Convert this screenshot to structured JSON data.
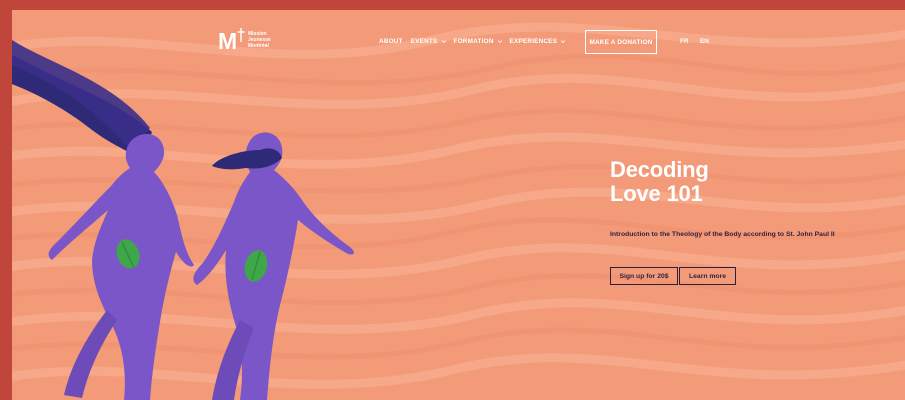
{
  "brand": {
    "logo_letter": "M",
    "logo_lines": [
      "Mission",
      "Jeunesse",
      "Montréal"
    ]
  },
  "nav": {
    "items": [
      {
        "label": "ABOUT",
        "has_dropdown": false
      },
      {
        "label": "EVENTS",
        "has_dropdown": true
      },
      {
        "label": "FORMATION",
        "has_dropdown": true
      },
      {
        "label": "EXPERIENCES",
        "has_dropdown": true
      }
    ],
    "donate_label": "MAKE A DONATION",
    "lang_fr": "FR",
    "lang_en": "EN"
  },
  "hero": {
    "title_line1": "Decoding",
    "title_line2": "Love 101",
    "subtitle": "Introduction to the Theology of the Body according to St. John Paul II",
    "primary_button": "Sign up for 20$",
    "secondary_button": "Learn more"
  },
  "colors": {
    "outer_background": "#c0463c",
    "hero_background": "#f39a79",
    "text_dark": "#2e1f3e",
    "figure_purple": "#7b56c9",
    "hair_navy": "#2f2a78",
    "leaf_green": "#3fa64a"
  }
}
